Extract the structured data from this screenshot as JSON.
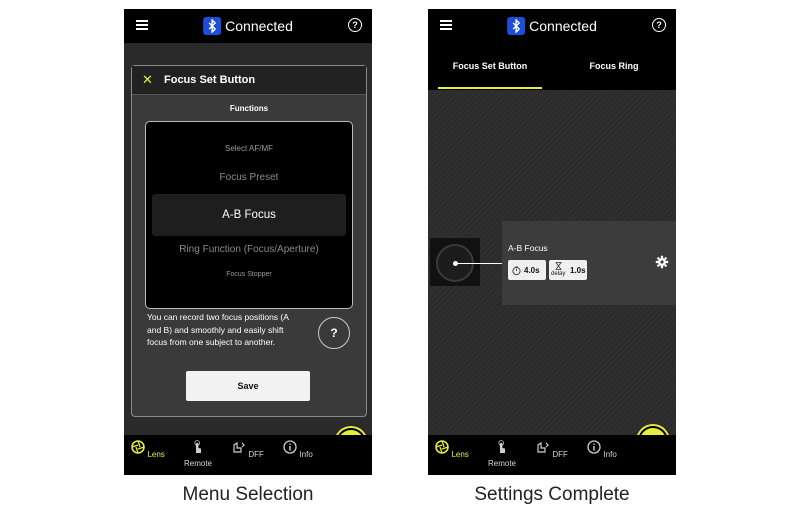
{
  "status": {
    "bluetooth_label": "Connected"
  },
  "nav": {
    "items": [
      {
        "label": "Lens",
        "icon": "aperture-icon",
        "active": true
      },
      {
        "label": "Remote",
        "icon": "touch-icon",
        "active": false
      },
      {
        "label": "DFF",
        "icon": "dff-icon",
        "active": false
      },
      {
        "label": "Info",
        "icon": "info-icon",
        "active": false
      }
    ]
  },
  "dialog": {
    "title": "Focus Set Button",
    "subtitle": "Functions",
    "options": [
      "Select AF/MF",
      "Focus Preset",
      "A-B Focus",
      "Ring Function (Focus/Aperture)",
      "Focus Stopper"
    ],
    "selected": "A-B Focus",
    "description": "You can record two focus positions (A and B) and smoothly and easily shift focus from one subject to another.",
    "help_label": "?",
    "save_label": "Save"
  },
  "tabs": [
    {
      "label": "Focus Set Button",
      "active": true
    },
    {
      "label": "Focus Ring",
      "active": false
    }
  ],
  "setting_card": {
    "title": "A-B Focus",
    "duration": "4.0s",
    "delay_label": "delay",
    "delay": "1.0s"
  },
  "captions": {
    "left": "Menu Selection",
    "right": "Settings Complete"
  },
  "colors": {
    "accent": "#e5ee3c",
    "bluetooth": "#1d4ed8"
  }
}
